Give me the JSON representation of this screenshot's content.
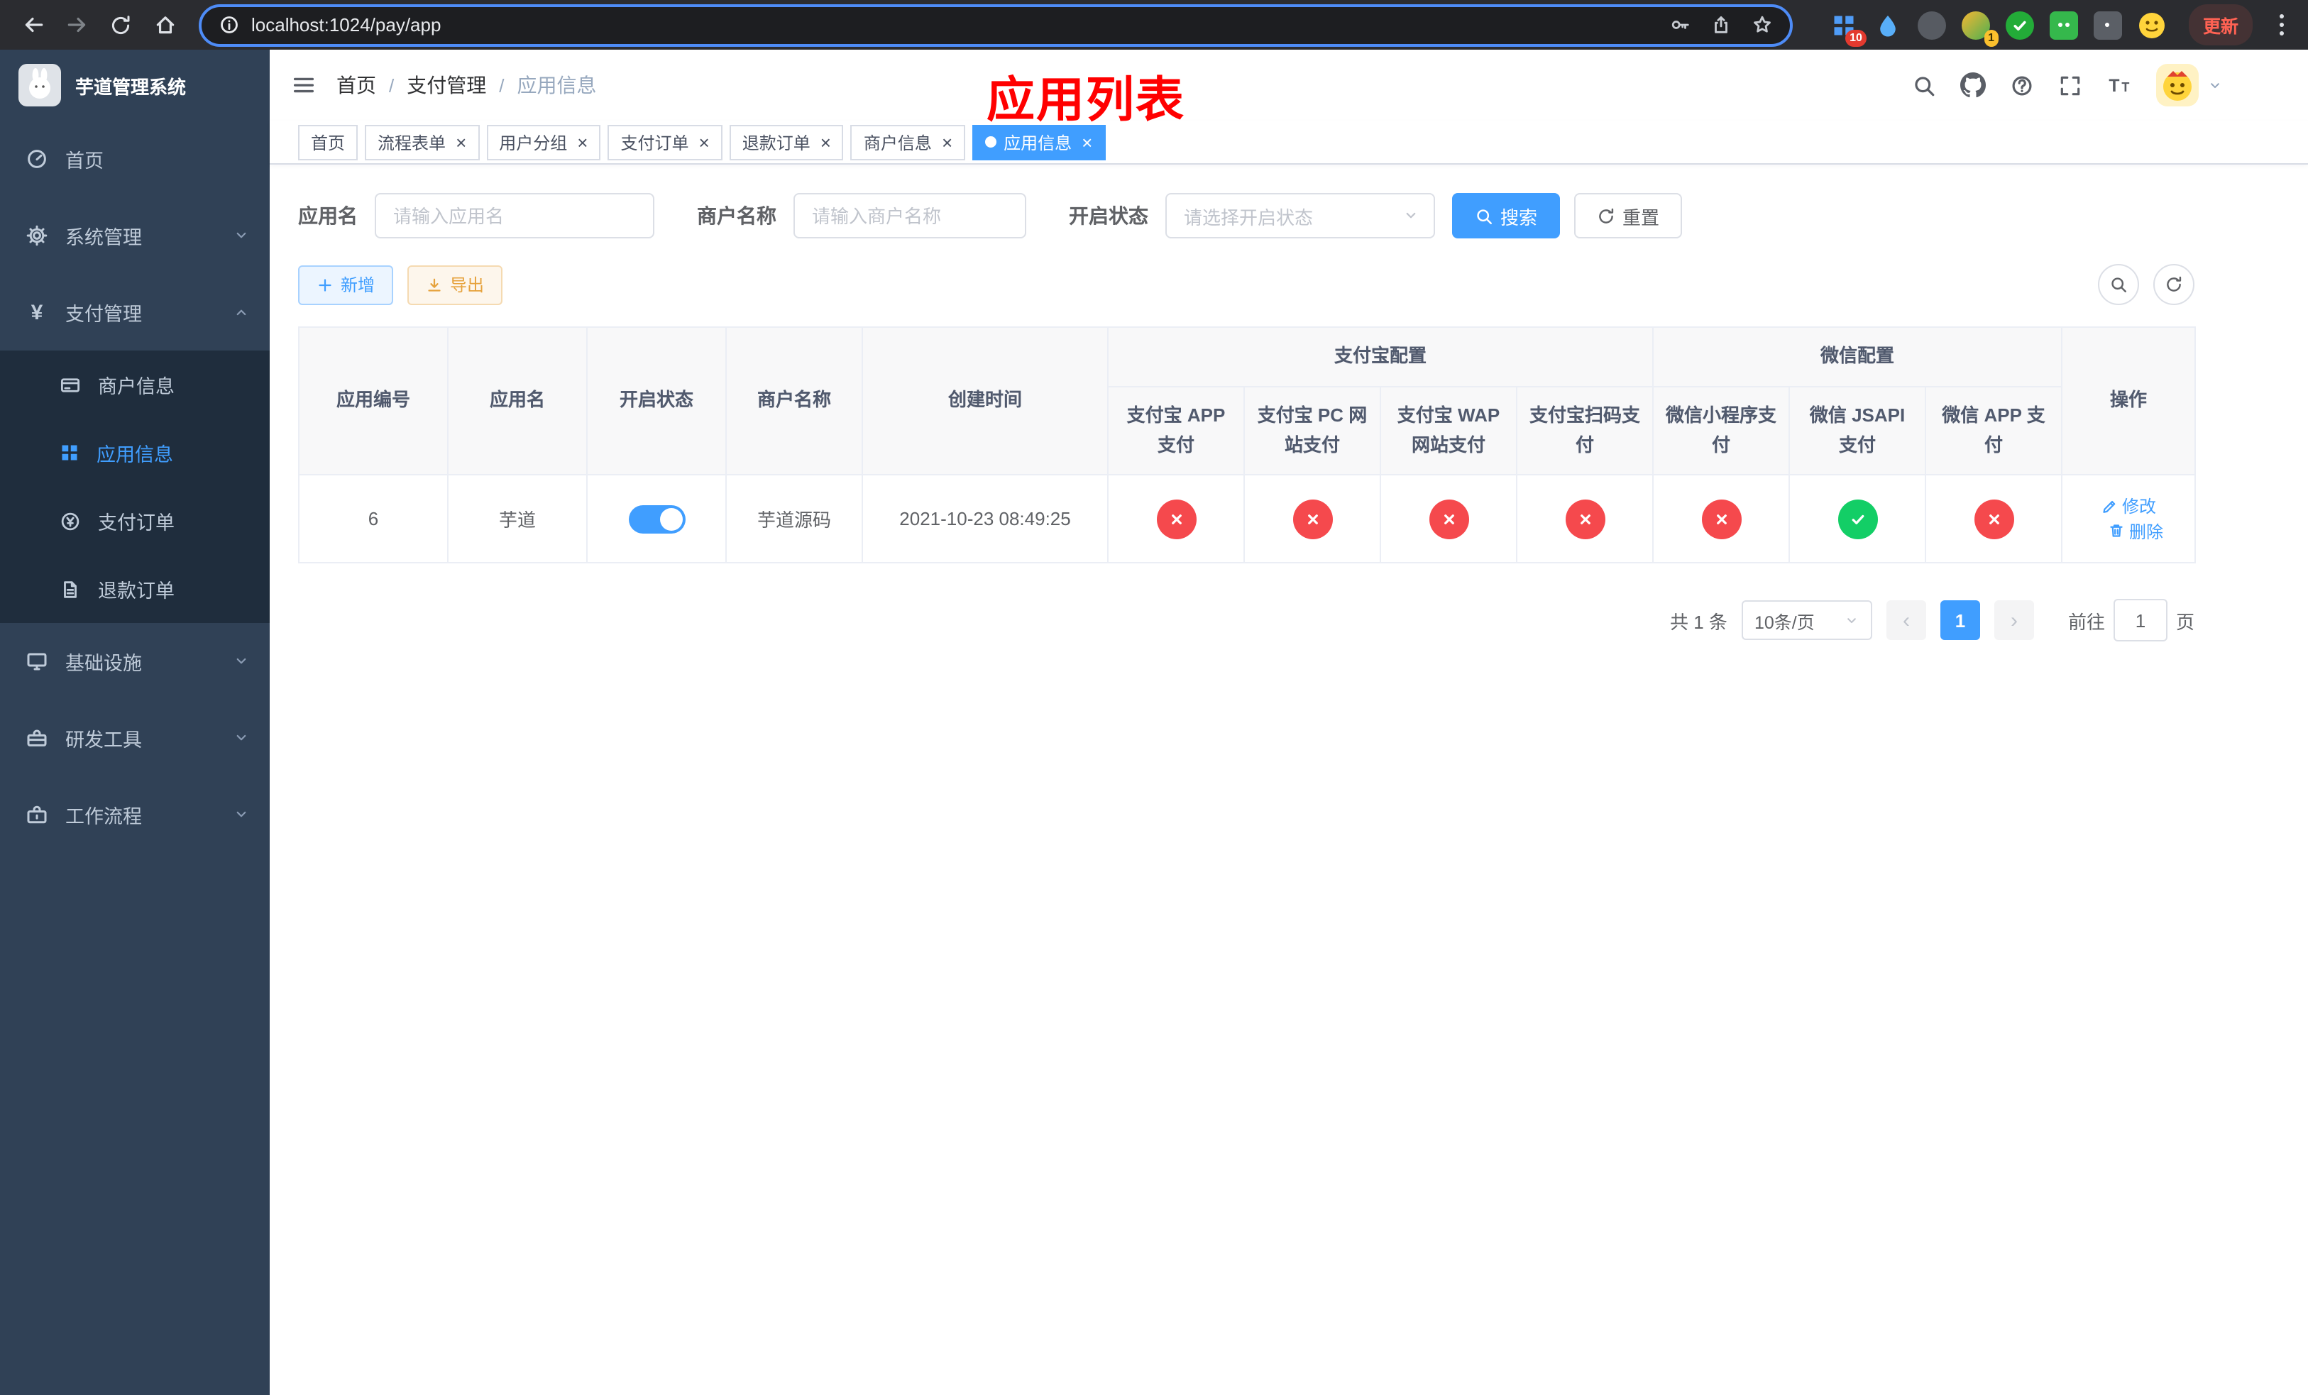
{
  "browser": {
    "url": "localhost:1024/pay/app",
    "update_label": "更新",
    "badge_ten": "10",
    "badge_one": "1"
  },
  "sidebar": {
    "title": "芋道管理系统",
    "items": [
      {
        "label": "首页"
      },
      {
        "label": "系统管理"
      },
      {
        "label": "支付管理",
        "children": [
          {
            "label": "商户信息"
          },
          {
            "label": "应用信息"
          },
          {
            "label": "支付订单"
          },
          {
            "label": "退款订单"
          }
        ]
      },
      {
        "label": "基础设施"
      },
      {
        "label": "研发工具"
      },
      {
        "label": "工作流程"
      }
    ]
  },
  "nav": {
    "breadcrumb": [
      "首页",
      "支付管理",
      "应用信息"
    ],
    "annotation": "应用列表"
  },
  "tabs": [
    {
      "label": "首页"
    },
    {
      "label": "流程表单"
    },
    {
      "label": "用户分组"
    },
    {
      "label": "支付订单"
    },
    {
      "label": "退款订单"
    },
    {
      "label": "商户信息"
    },
    {
      "label": "应用信息"
    }
  ],
  "filters": {
    "app_name_label": "应用名",
    "app_name_placeholder": "请输入应用名",
    "merchant_label": "商户名称",
    "merchant_placeholder": "请输入商户名称",
    "status_label": "开启状态",
    "status_placeholder": "请选择开启状态",
    "search_label": "搜索",
    "reset_label": "重置"
  },
  "actions": {
    "add_label": "新增",
    "export_label": "导出"
  },
  "table": {
    "columns": {
      "app_id": "应用编号",
      "app_name": "应用名",
      "status": "开启状态",
      "merchant": "商户名称",
      "created": "创建时间",
      "actions": "操作"
    },
    "groups": {
      "alipay": "支付宝配置",
      "wechat": "微信配置"
    },
    "sub_columns": [
      "支付宝 APP 支付",
      "支付宝 PC 网站支付",
      "支付宝 WAP 网站支付",
      "支付宝扫码支付",
      "微信小程序支付",
      "微信 JSAPI 支付",
      "微信 APP 支付"
    ],
    "row": {
      "app_id": "6",
      "app_name": "芋道",
      "status_on": true,
      "merchant": "芋道源码",
      "created": "2021-10-23 08:49:25",
      "channels": [
        "no",
        "no",
        "no",
        "no",
        "no",
        "yes",
        "no"
      ],
      "edit_label": "修改",
      "delete_label": "删除"
    }
  },
  "pagination": {
    "total_text": "共 1 条",
    "page_size": "10条/页",
    "current_page": "1",
    "goto_label": "前往",
    "goto_value": "1",
    "page_suffix": "页"
  },
  "colors": {
    "accent": "#409eff",
    "danger": "#f5494d",
    "success": "#13ce66",
    "warning": "#e6a23c",
    "annotation_red": "#ff0000",
    "sidebar_bg": "#304156",
    "submenu_bg": "#1f2d3d"
  }
}
